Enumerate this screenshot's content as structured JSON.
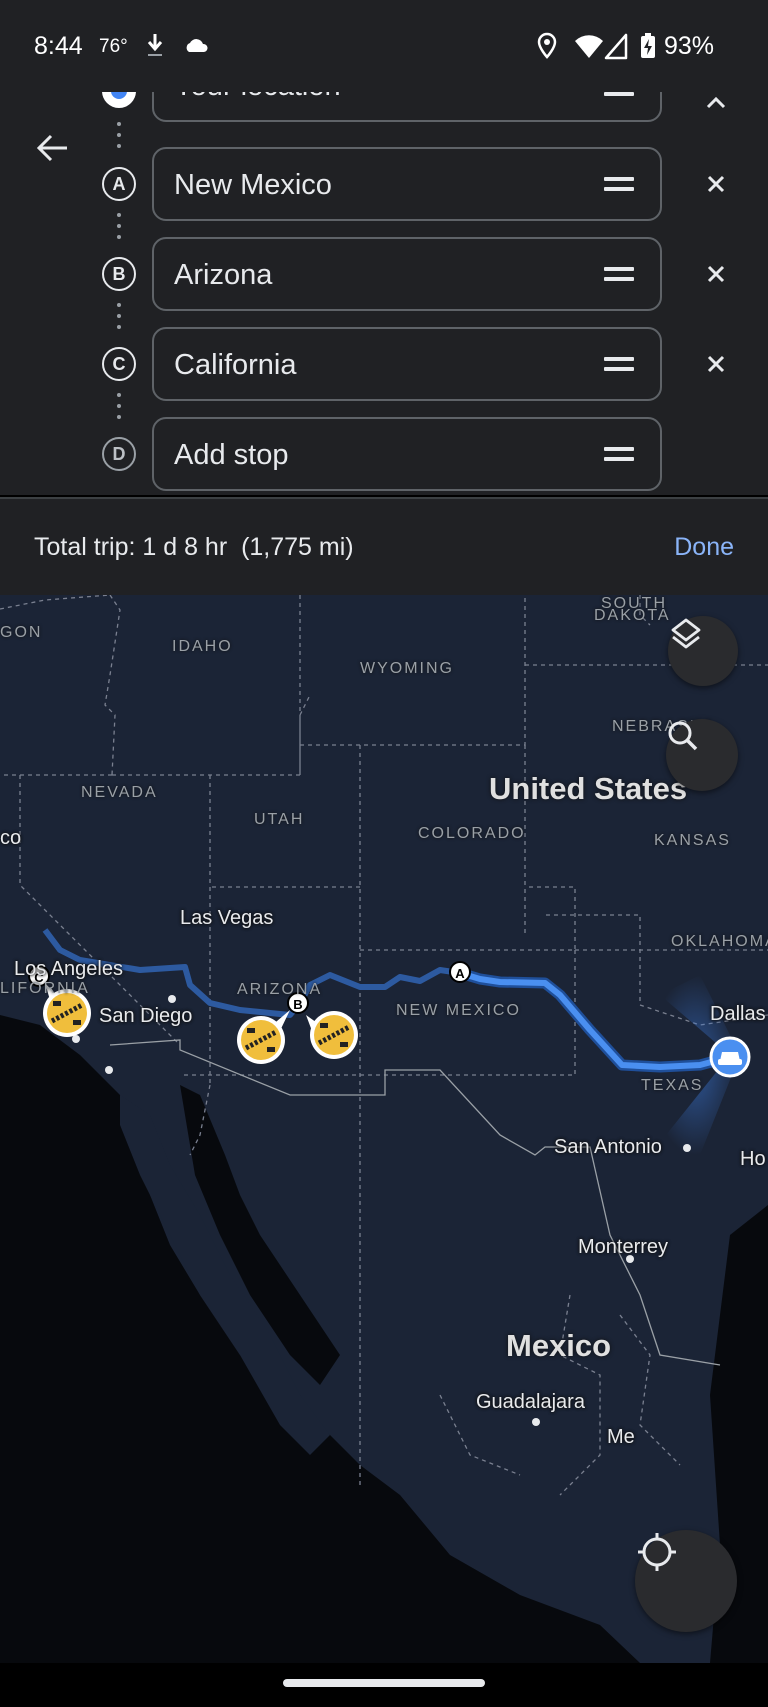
{
  "status_bar": {
    "time": "8:44",
    "temperature": "76°",
    "battery": "93%",
    "icons": [
      "download-icon",
      "cloud-icon",
      "location-icon",
      "wifi-icon",
      "signal-icon",
      "battery-charging-icon"
    ]
  },
  "directions": {
    "stops": [
      {
        "marker": "",
        "value": "Your location",
        "type": "origin"
      },
      {
        "marker": "A",
        "value": "New Mexico",
        "type": "stop"
      },
      {
        "marker": "B",
        "value": "Arizona",
        "type": "stop"
      },
      {
        "marker": "C",
        "value": "California",
        "type": "stop"
      },
      {
        "marker": "D",
        "value": "",
        "placeholder": "Add stop",
        "type": "add"
      }
    ]
  },
  "summary": {
    "total_label": "Total trip: 1 d 8 hr",
    "distance": "(1,775 mi)",
    "done_label": "Done"
  },
  "map": {
    "states": [
      "GON",
      "IDAHO",
      "WYOMING",
      "SOUTH",
      "DAKOTA",
      "NEBRASKA",
      "NEVADA",
      "UTAH",
      "COLORADO",
      "KANSAS",
      "LIFORNIA",
      "ARIZONA",
      "NEW MEXICO",
      "OKLAHOMA",
      "TEXAS"
    ],
    "countries": [
      "United States",
      "Mexico"
    ],
    "cities": [
      "Las Vegas",
      "Los Angeles",
      "San Diego",
      "Dallas",
      "San Antonio",
      "Ho",
      "Monterrey",
      "Guadalajara",
      "Me",
      "co"
    ],
    "route_markers": [
      "A",
      "B",
      "C"
    ],
    "colors": {
      "route_active": "#4a8ff0",
      "route_inactive": "#2d5aa0",
      "incident": "#f0be3c"
    }
  }
}
